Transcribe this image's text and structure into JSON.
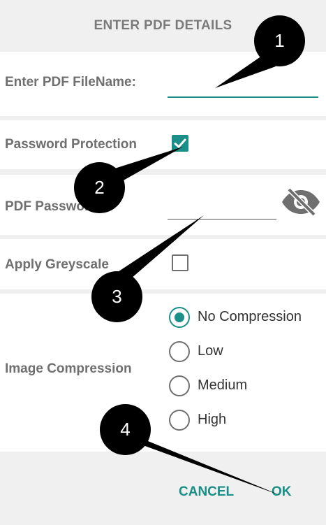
{
  "dialog": {
    "title": "ENTER PDF DETAILS",
    "filename": {
      "label": "Enter PDF FileName:",
      "value": ""
    },
    "password_protection": {
      "label": "Password Protection",
      "checked": true
    },
    "password": {
      "label": "PDF Password",
      "value": "",
      "icon": "eye-off-icon"
    },
    "greyscale": {
      "label": "Apply Greyscale",
      "checked": false
    },
    "compression": {
      "label": "Image Compression",
      "options": [
        "No Compression",
        "Low",
        "Medium",
        "High"
      ],
      "selected": "No Compression"
    },
    "buttons": {
      "cancel": "CANCEL",
      "ok": "OK"
    }
  },
  "annotations": [
    "1",
    "2",
    "3",
    "4"
  ],
  "colors": {
    "accent": "#1a8f87",
    "label": "#6f6f6f",
    "marker": "#000000"
  }
}
